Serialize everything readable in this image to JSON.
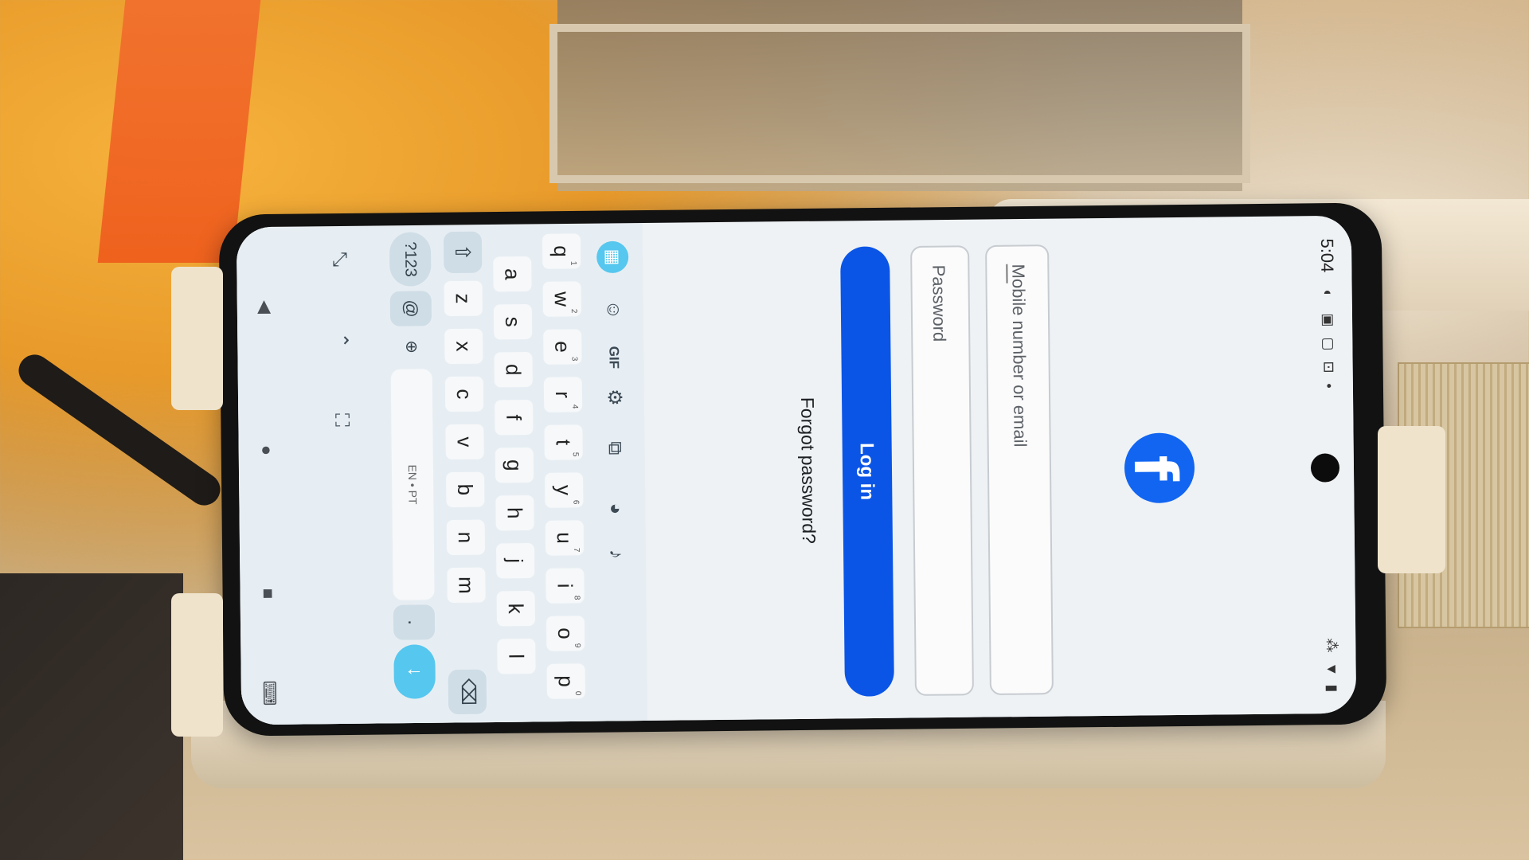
{
  "status_bar": {
    "time": "5:04"
  },
  "login": {
    "mobile_placeholder": "Mobile number or email",
    "password_placeholder": "Password",
    "login_button": "Log in",
    "forgot_password": "Forgot password?"
  },
  "keyboard": {
    "toolbar": {
      "gif_label": "GIF"
    },
    "row1": [
      {
        "k": "q",
        "n": "1"
      },
      {
        "k": "w",
        "n": "2"
      },
      {
        "k": "e",
        "n": "3"
      },
      {
        "k": "r",
        "n": "4"
      },
      {
        "k": "t",
        "n": "5"
      },
      {
        "k": "y",
        "n": "6"
      },
      {
        "k": "u",
        "n": "7"
      },
      {
        "k": "i",
        "n": "8"
      },
      {
        "k": "o",
        "n": "9"
      },
      {
        "k": "p",
        "n": "0"
      }
    ],
    "row2": [
      "a",
      "s",
      "d",
      "f",
      "g",
      "h",
      "j",
      "k",
      "l"
    ],
    "row3": [
      "z",
      "x",
      "c",
      "v",
      "b",
      "n",
      "m"
    ],
    "numbers_label": "?123",
    "at_label": "@",
    "space_label": "EN • PT",
    "period_label": ".",
    "shift_symbol": "⇧",
    "backspace_symbol": "⌫",
    "enter_symbol": "↓"
  },
  "colors": {
    "facebook_blue": "#1165f1",
    "login_button": "#0b55e6",
    "keyboard_accent": "#56c7ee"
  }
}
